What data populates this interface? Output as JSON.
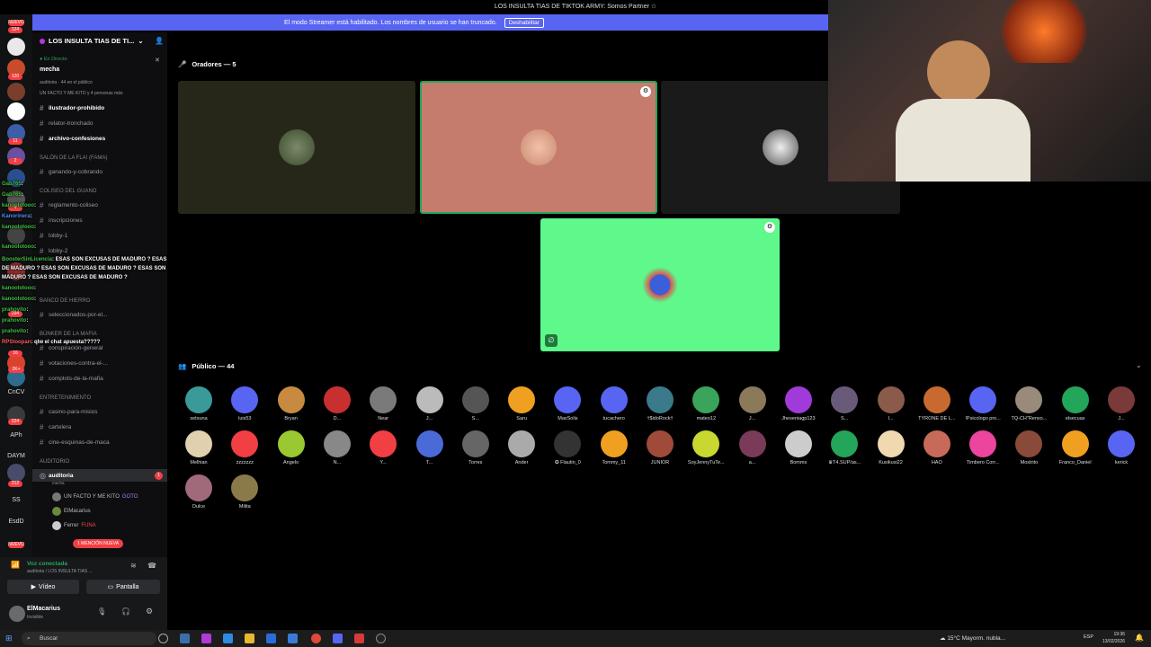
{
  "window": {
    "title": "LOS INSULTA TIAS DE TIKTOK ARMY: Somos Partner ☆"
  },
  "streamer_banner": {
    "text": "El modo Streamer está habilitado. Los nombres de usuario se han truncado.",
    "button": "Deshabilitar"
  },
  "rail": {
    "top_badge": "NUEVO",
    "badges": [
      "124",
      "120",
      "11",
      "2",
      "4",
      "294",
      "16",
      "2K+",
      "224",
      "212"
    ],
    "labels": [
      "CnCV",
      "APh",
      "DAYM",
      "SS",
      "EsdD"
    ],
    "bottom_badge": "NUEVO"
  },
  "server": {
    "name": "LOS INSULTA TIAS DE TI...",
    "live_label": "En Directo",
    "live_name": "mecha",
    "live_sub1": "auditoria",
    "live_sub1_count": "44 en el público",
    "live_sub2": "UN FACTO Y ME KITO y 4 personas más"
  },
  "channels": [
    {
      "name": "ilustrador-prohibido",
      "bold": true
    },
    {
      "name": "relator-tronchado",
      "bold": false
    },
    {
      "name": "archivo-confesiones",
      "bold": true
    }
  ],
  "categories": {
    "salon": "SALÓN DE LA FLA! (FAMA)",
    "coliseo": "COLISEO DEL GUANO",
    "banco": "BANCO DE HIERRO",
    "bunker": "BÚNKER DE LA MAFIA",
    "entretenimiento": "ENTRETENIMIENTO",
    "auditorio": "AUDITORIO"
  },
  "salon_channels": [
    "ganando-y-cobrando"
  ],
  "coliseo_channels": [
    "reglamento-coliseo",
    "inscripciones",
    "lobby-1",
    "lobby-2"
  ],
  "banco_channels": [
    "seleccionados-por-el..."
  ],
  "bunker_channels": [
    "conspiración-general",
    "votaciones-contra-el-...",
    "complots-de-la-mafia"
  ],
  "entre_channels": [
    "casino-para-misios",
    "cartelera",
    "cine-esquinas-de-maca"
  ],
  "auditorio": {
    "channel": "auditoria",
    "sub": "mecha",
    "badge": "1",
    "users": [
      "UN FACTO Y ME KITO",
      "ElMacarius",
      "Ferrer"
    ],
    "tags": [
      "GOTO",
      "FUNA"
    ],
    "mention": "1 MENCIÓN NUEVA"
  },
  "chat": [
    {
      "name": "Gab765",
      "msg": ":"
    },
    {
      "name": "Gab765",
      "msg": ":"
    },
    {
      "name": "kanoolotooo",
      "msg": ":"
    },
    {
      "name": "Kanorinera",
      "msg": ":"
    },
    {
      "name": "kanoolotooo",
      "msg": ":"
    },
    {
      "name": "kanoolotooo",
      "msg": ":"
    },
    {
      "name": "BoosterSinLicencia",
      "msg": ": ESAS SON EXCUSAS DE MADURO ? ESAS SON EXCUSAS"
    },
    {
      "name": "",
      "msg": "DE MADURO ? ESAS SON EXCUSAS DE MADURO ? ESAS SON EXCUSAS DE"
    },
    {
      "name": "",
      "msg": "MADURO ? ESAS SON EXCUSAS DE MADURO ?"
    },
    {
      "name": "kanoolotooo",
      "msg": ":"
    },
    {
      "name": "kanoolotooo",
      "msg": ":"
    },
    {
      "name": "prahovito",
      "msg": ":"
    },
    {
      "name": "prahovito",
      "msg": ":"
    },
    {
      "name": "prahovito",
      "msg": ":"
    },
    {
      "name": "RPStoopan",
      "msg": ": qlw el chat apuesta?????"
    }
  ],
  "voice": {
    "status": "Voz conectada",
    "location": "auditoria / LOS INSULTA TIAS ...",
    "video_btn": "Vídeo",
    "screen_btn": "Pantalla"
  },
  "user": {
    "name": "ElMacarius",
    "status": "Invisible"
  },
  "stage": {
    "speakers_header": "Oradores — 5",
    "audience_header": "Público — 44",
    "audience": [
      "setsuna",
      "luis53",
      "Bryan",
      "D...",
      "Near",
      "J...",
      "S...",
      "Saru",
      "MaxSolis",
      "tucachero",
      "†$idoRock†",
      "mateo12",
      "J...",
      "Jheseniagp123",
      "S...",
      "I...",
      "TYRONE DE L...",
      "!Psicologo pro...",
      "TQ-CH\"Renxo...",
      "elsecuas",
      "J...",
      "Melhian",
      "zzzzzzz",
      "Angelo",
      "N...",
      "Y...",
      "T...",
      "Torres",
      "Ander",
      "✪ Flautin_0",
      "Tommy_11",
      "JUNIOR",
      "SoyJennyTuTe...",
      "a...",
      "Bomms",
      "♛T4.SUP/as...",
      "Kusikusi22",
      "HAO",
      "Timbero Corr...",
      "Mostrito",
      "Franco_Daniel",
      "kerick",
      "Dulce",
      "Milita"
    ]
  },
  "taskbar": {
    "search": "Buscar",
    "weather": "15°C Mayorm. nubla...",
    "lang": "ESP",
    "time": "19:36",
    "date": "13/02/2026"
  },
  "colors": {
    "accent": "#5865f2",
    "online": "#23a55a",
    "danger": "#f23f43",
    "speaking_tile": "#c67c6c",
    "green_tile": "#5ef88b"
  }
}
